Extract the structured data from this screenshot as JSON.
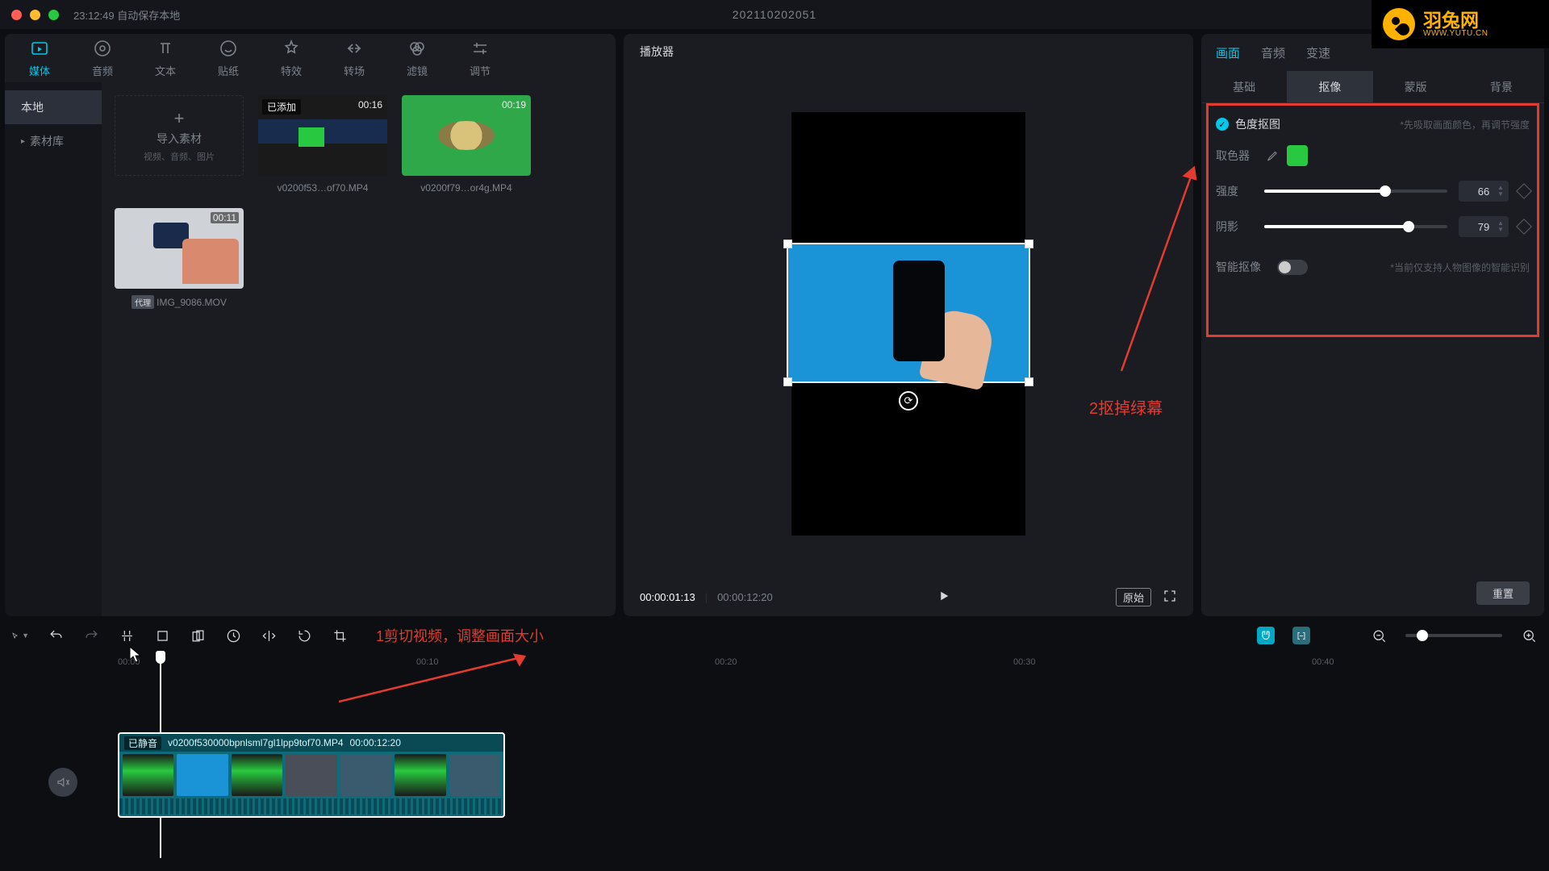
{
  "title": {
    "autosave_label": "23:12:49 自动保存本地",
    "project_name": "202110202051"
  },
  "logo": {
    "cn": "羽兔网",
    "en": "WWW.YUTU.CN"
  },
  "media_tabs": [
    {
      "key": "media",
      "label": "媒体",
      "active": true
    },
    {
      "key": "audio",
      "label": "音频"
    },
    {
      "key": "text",
      "label": "文本"
    },
    {
      "key": "sticker",
      "label": "贴纸"
    },
    {
      "key": "effect",
      "label": "特效"
    },
    {
      "key": "transition",
      "label": "转场"
    },
    {
      "key": "filter",
      "label": "滤镜"
    },
    {
      "key": "adjust",
      "label": "调节"
    }
  ],
  "media_side": [
    {
      "label": "本地",
      "active": true
    },
    {
      "label": "素材库",
      "active": false,
      "has_children": true
    }
  ],
  "import_box": {
    "title": "导入素材",
    "subtitle": "视频、音频、图片",
    "plus": "+"
  },
  "clips": [
    {
      "badge": "已添加",
      "dur": "00:16",
      "name": "v0200f53…of70.MP4",
      "thumb": "tg1"
    },
    {
      "badge": "",
      "dur": "00:19",
      "name": "v0200f79…or4g.MP4",
      "thumb": "tg2"
    },
    {
      "badge": "",
      "dur": "00:11",
      "name": "IMG_9086.MOV",
      "tag": "代理",
      "thumb": "tg3"
    }
  ],
  "player": {
    "title": "播放器",
    "time_current": "00:00:01:13",
    "time_total": "00:00:12:20",
    "original_btn": "原始"
  },
  "inspector": {
    "tabs": [
      {
        "label": "画面",
        "active": true
      },
      {
        "label": "音频"
      },
      {
        "label": "变速"
      }
    ],
    "subtabs": [
      {
        "label": "基础"
      },
      {
        "label": "抠像",
        "active": true
      },
      {
        "label": "蒙版"
      },
      {
        "label": "背景"
      }
    ],
    "chroma": {
      "title": "色度抠图",
      "hint": "*先吸取画面颜色，再调节强度",
      "picker_label": "取色器",
      "color": "#28c940",
      "intensity_label": "强度",
      "intensity_value": "66",
      "intensity_pct": 66,
      "shadow_label": "阴影",
      "shadow_value": "79",
      "shadow_pct": 79
    },
    "smart": {
      "label": "智能抠像",
      "hint": "*当前仅支持人物图像的智能识别"
    },
    "reset": "重置"
  },
  "annotations": {
    "one": "1剪切视频，调整画面大小",
    "two": "2抠掉绿幕"
  },
  "timeline": {
    "ruler": [
      "00:00",
      "00:10",
      "00:20",
      "00:30",
      "00:40"
    ],
    "clip": {
      "mute_tag": "已静音",
      "name": "v0200f530000bpnlsml7gl1lpp9tof70.MP4",
      "dur": "00:00:12:20"
    }
  }
}
